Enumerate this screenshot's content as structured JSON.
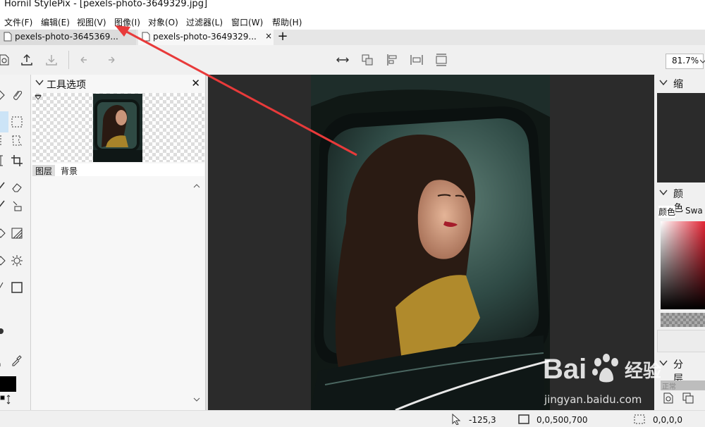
{
  "window": {
    "title": "Hornil StylePix - [pexels-photo-3649329.jpg]"
  },
  "menu": [
    "文件(F)",
    "编辑(E)",
    "视图(V)",
    "图像(I)",
    "对象(O)",
    "过滤器(L)",
    "窗口(W)",
    "帮助(H)"
  ],
  "tabs": [
    {
      "label": "pexels-photo-3645369...",
      "close": "×"
    },
    {
      "label": "pexels-photo-3649329...",
      "close": "×"
    }
  ],
  "newtab": "+",
  "zoom": "81.7%",
  "tool_options": {
    "title": "工具选项",
    "close": "✕",
    "layer_tabs": [
      "图层",
      "背景"
    ]
  },
  "right_panels": {
    "thumbnail": "缩略图",
    "color": "颜色",
    "color_tabs": [
      "颜色",
      "Swa"
    ],
    "layers": "分层",
    "blend_mode": "正常"
  },
  "status": {
    "cursor": "-125,3",
    "image": "0,0,500,700",
    "selection": "0,0,0,0"
  },
  "watermark": {
    "brand": "Bai",
    "brand2": "经验",
    "url": "jingyan.baidu.com"
  },
  "colors": {
    "accent": "#e83a3a",
    "selection": "#cce4f7"
  }
}
